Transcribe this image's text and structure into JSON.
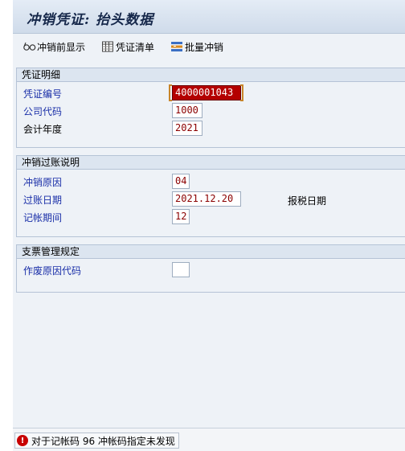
{
  "window": {
    "title": "冲销凭证: 抬头数据"
  },
  "toolbar": {
    "items": [
      {
        "label": "冲销前显示",
        "icon": "glasses-icon"
      },
      {
        "label": "凭证清单",
        "icon": "table-icon"
      },
      {
        "label": "批量冲销",
        "icon": "mass-reverse-icon"
      }
    ]
  },
  "groups": {
    "document_details": {
      "title": "凭证明细",
      "doc_number": {
        "label": "凭证编号",
        "value": "4000001043"
      },
      "company_code": {
        "label": "公司代码",
        "value": "1000"
      },
      "fiscal_year": {
        "label": "会计年度",
        "value": "2021"
      }
    },
    "reversal_posting": {
      "title": "冲销过账说明",
      "reason": {
        "label": "冲销原因",
        "value": "04"
      },
      "posting_date": {
        "label": "过账日期",
        "value": "2021.12.20"
      },
      "tax_report_date": {
        "label": "报税日期"
      },
      "posting_period": {
        "label": "记帐期间",
        "value": "12"
      }
    },
    "check_management": {
      "title": "支票管理规定",
      "void_reason": {
        "label": "作废原因代码",
        "value": ""
      }
    }
  },
  "status": {
    "type": "error",
    "message": "对于记帐码 96 冲帐码指定未发现"
  },
  "colors": {
    "field_text": "#8b0000",
    "focus_bg": "#b40000",
    "link_label": "#1a2fa8",
    "title": "#15274a"
  }
}
